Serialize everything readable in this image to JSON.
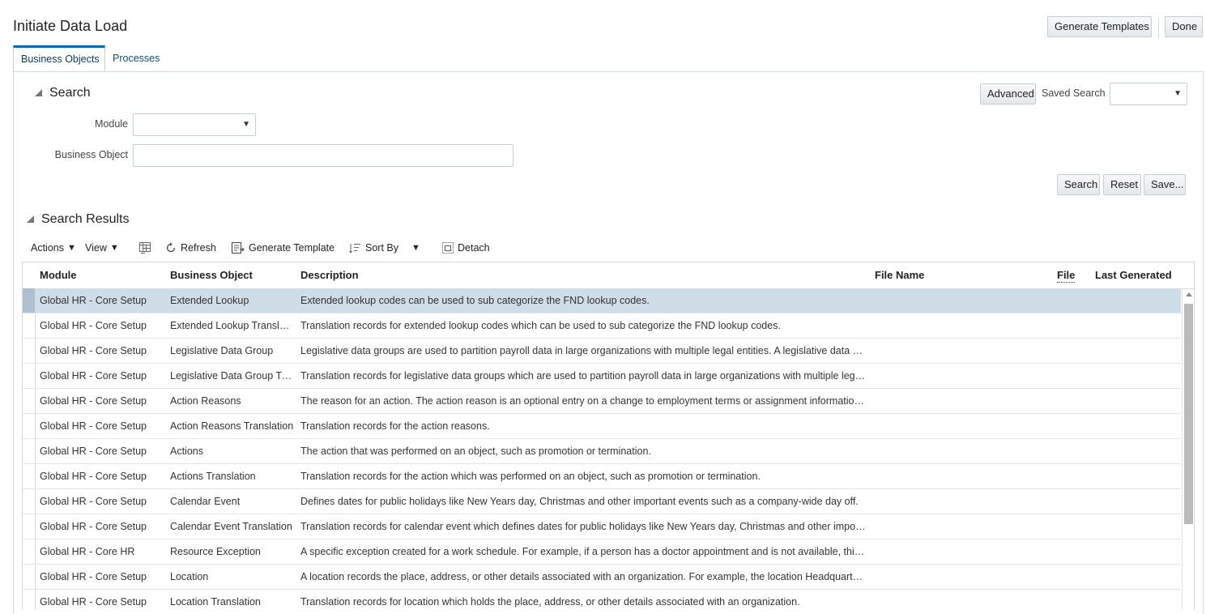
{
  "page": {
    "title": "Initiate Data Load"
  },
  "header_buttons": {
    "generate_templates": "Generate Templates",
    "done": "Done"
  },
  "tabs": [
    {
      "label": "Business Objects",
      "active": true
    },
    {
      "label": "Processes",
      "active": false
    }
  ],
  "search": {
    "title": "Search",
    "advanced_label": "Advanced",
    "saved_search_label": "Saved Search",
    "saved_search_value": "",
    "module_label": "Module",
    "module_value": "",
    "business_object_label": "Business Object",
    "business_object_value": "",
    "search_button": "Search",
    "reset_button": "Reset",
    "save_button": "Save..."
  },
  "results": {
    "title": "Search Results",
    "toolbar": {
      "actions": "Actions",
      "view": "View",
      "refresh": "Refresh",
      "generate_template": "Generate Template",
      "sort_by": "Sort By",
      "detach": "Detach"
    },
    "columns": [
      "Module",
      "Business Object",
      "Description",
      "File Name",
      "File",
      "Last Generated"
    ],
    "rows": [
      {
        "module": "Global HR - Core Setup",
        "object": "Extended Lookup",
        "description": "Extended lookup codes can be used to sub categorize the FND lookup codes.",
        "selected": true
      },
      {
        "module": "Global HR - Core Setup",
        "object": "Extended Lookup Translat…",
        "description": "Translation records for extended lookup codes which can be used to sub categorize the FND lookup codes.",
        "selected": false
      },
      {
        "module": "Global HR - Core Setup",
        "object": "Legislative Data Group",
        "description": "Legislative data groups are used to partition payroll data in large organizations with multiple legal entities. A legislative data group…",
        "selected": false
      },
      {
        "module": "Global HR - Core Setup",
        "object": "Legislative Data Group Tr…",
        "description": "Translation records for legislative data groups which are used to partition payroll data in large organizations with multiple legal enti…",
        "selected": false
      },
      {
        "module": "Global HR - Core Setup",
        "object": "Action Reasons",
        "description": "The reason for an action. The action reason is an optional entry on a change to employment terms or assignment information. For…",
        "selected": false
      },
      {
        "module": "Global HR - Core Setup",
        "object": "Action Reasons Translation",
        "description": "Translation records for the action reasons.",
        "selected": false
      },
      {
        "module": "Global HR - Core Setup",
        "object": "Actions",
        "description": "The action that was performed on an object, such as promotion or termination.",
        "selected": false
      },
      {
        "module": "Global HR - Core Setup",
        "object": "Actions Translation",
        "description": "Translation records for the action which was performed on an object, such as promotion or termination.",
        "selected": false
      },
      {
        "module": "Global HR - Core Setup",
        "object": "Calendar Event",
        "description": "Defines dates for public holidays like New Years day, Christmas and other important events such as a company-wide day off.",
        "selected": false
      },
      {
        "module": "Global HR - Core Setup",
        "object": "Calendar Event Translation",
        "description": "Translation records for calendar event which defines dates for public holidays like New Years day, Christmas and other important e…",
        "selected": false
      },
      {
        "module": "Global HR - Core HR",
        "object": "Resource Exception",
        "description": "A specific exception created for a work schedule. For example, if a person has a doctor appointment and is not available, this exce…",
        "selected": false
      },
      {
        "module": "Global HR - Core Setup",
        "object": "Location",
        "description": "A location records the place, address, or other details associated with an organization. For example, the location Headquarters ca…",
        "selected": false
      },
      {
        "module": "Global HR - Core Setup",
        "object": "Location Translation",
        "description": "Translation records for location which holds the place, address, or other details associated with an organization.",
        "selected": false
      }
    ]
  }
}
